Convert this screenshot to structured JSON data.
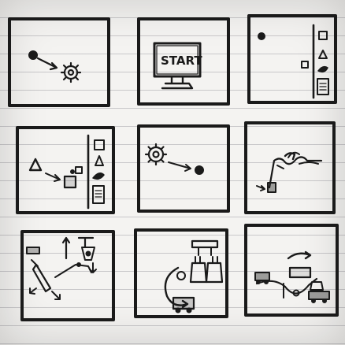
{
  "sheet": {
    "panel_count": 9,
    "panels": [
      {
        "id": 1,
        "content": [
          "dot",
          "arrow",
          "gear"
        ]
      },
      {
        "id": 2,
        "content": [
          "monitor",
          "start-label"
        ],
        "label": "START"
      },
      {
        "id": 3,
        "content": [
          "dot",
          "side-toolbar"
        ]
      },
      {
        "id": 4,
        "content": [
          "triangle",
          "squares",
          "side-toolbar"
        ]
      },
      {
        "id": 5,
        "content": [
          "gear",
          "arrow",
          "dot"
        ]
      },
      {
        "id": 6,
        "content": [
          "wavy-track",
          "small-figures"
        ]
      },
      {
        "id": 7,
        "content": [
          "machinery-sketch",
          "arrows"
        ]
      },
      {
        "id": 8,
        "content": [
          "bottles",
          "rack",
          "cart"
        ]
      },
      {
        "id": 9,
        "content": [
          "curve-track",
          "arrow",
          "vehicles"
        ]
      }
    ]
  },
  "colors": {
    "paper": "#f4f3f1",
    "ink": "#1a1a1a",
    "rule_line": "#8a8a95"
  }
}
